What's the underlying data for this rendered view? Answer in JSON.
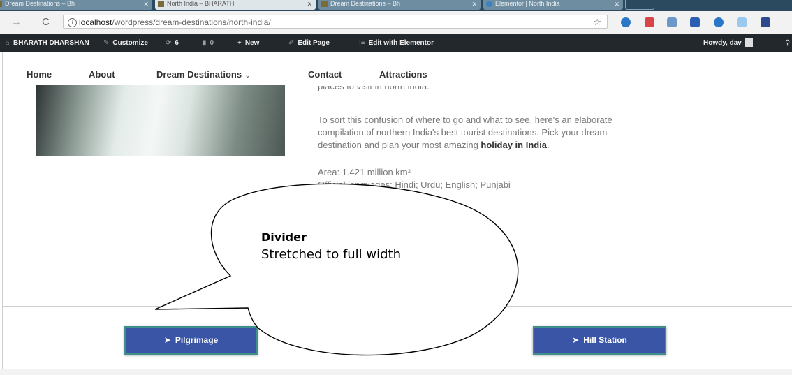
{
  "browser": {
    "tabs": [
      {
        "label": "Dream Destinations – Bh",
        "active": false
      },
      {
        "label": "North India – BHARATH",
        "active": true
      },
      {
        "label": "Dream Destinations – Bh",
        "active": false
      },
      {
        "label": "Elementor | North India",
        "active": false
      }
    ],
    "url_host": "localhost",
    "url_path": "/wordpress/dream-destinations/north-india/"
  },
  "admin_bar": {
    "site_name": "BHARATH DHARSHAN",
    "customize": "Customize",
    "updates_count": "6",
    "comments_count": "0",
    "new_label": "New",
    "edit_page": "Edit Page",
    "edit_elementor": "Edit with Elementor",
    "howdy": "Howdy, dav"
  },
  "nav": {
    "home": "Home",
    "about": "About",
    "dream_destinations": "Dream Destinations",
    "contact": "Contact",
    "attractions": "Attractions"
  },
  "content": {
    "intro_tail": "places to visit in north india.",
    "para_lines": [
      "To sort this confusion of where to go and what to see, here's an elaborate",
      "compilation of northern India's best tourist destinations. Pick your dream"
    ],
    "para_line3_prefix": "destination and plan your most amazing ",
    "para_line3_bold": "holiday in India",
    "para_line3_suffix": ".",
    "area": "Area:  1.421 million km²",
    "languages": "Official languages: Hindi; Urdu; English; Punjabi"
  },
  "callout": {
    "title": "Divider",
    "subtitle": "Stretched to full width"
  },
  "buttons": {
    "pilgrimage": "Pilgrimage",
    "hill_station": "Hill Station"
  },
  "icons": {
    "button_icon": "paper-plane-icon",
    "arrow_glyph": "➤"
  },
  "colors": {
    "button_bg": "#3a55a5",
    "button_border": "#3f8f8a",
    "admin_bar": "#23282d"
  }
}
